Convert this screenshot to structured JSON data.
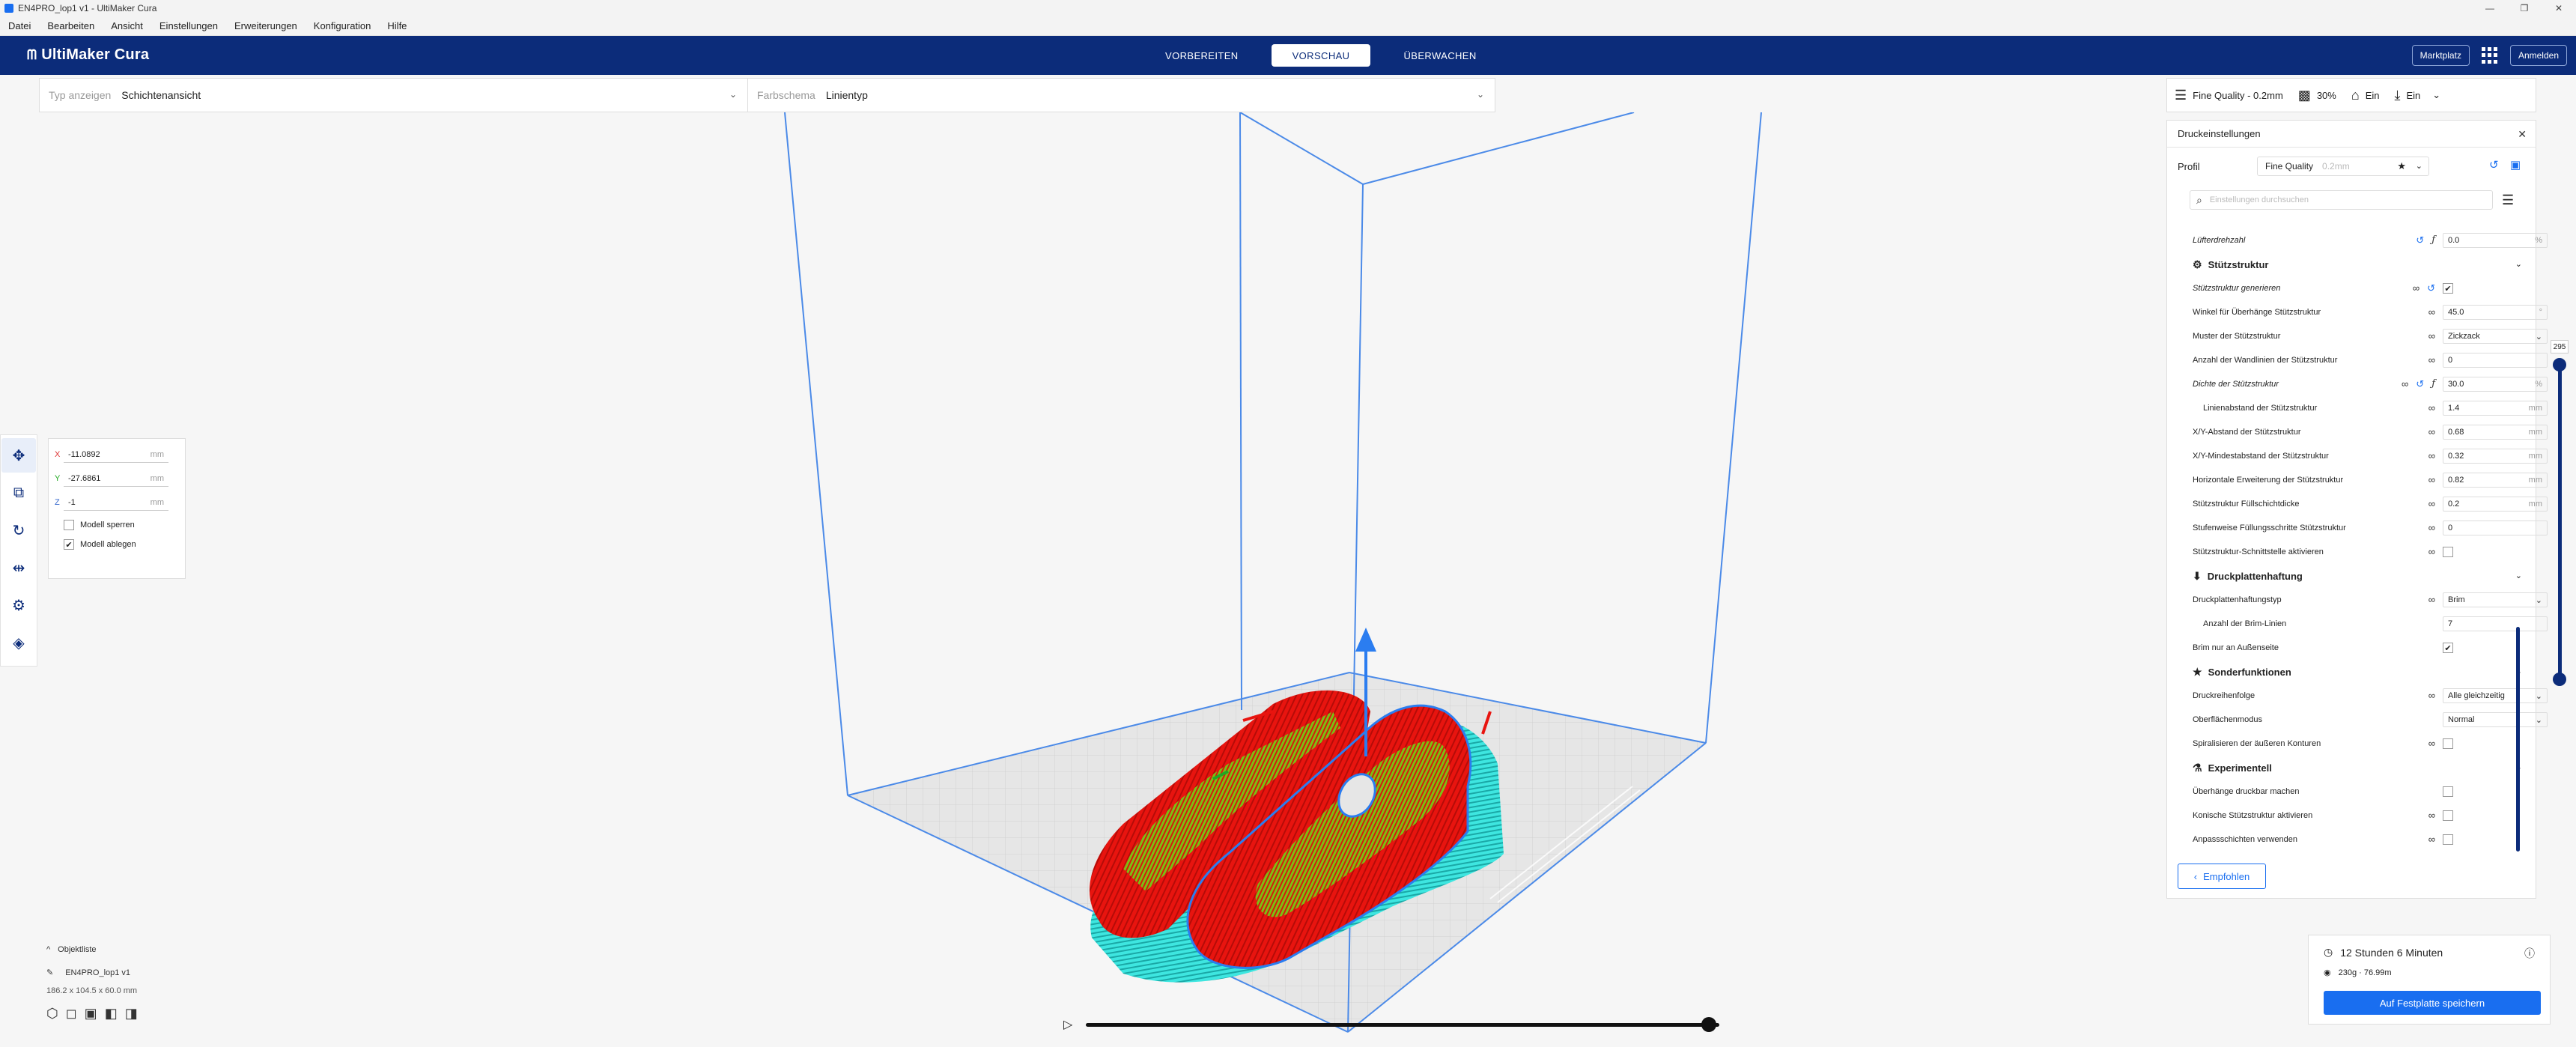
{
  "window": {
    "title": "EN4PRO_lop1 v1 - UltiMaker Cura",
    "controls": [
      "—",
      "❐",
      "✕"
    ]
  },
  "menu": [
    "Datei",
    "Bearbeiten",
    "Ansicht",
    "Einstellungen",
    "Erweiterungen",
    "Konfiguration",
    "Hilfe"
  ],
  "header": {
    "logo": "UltiMaker Cura",
    "stages": [
      "VORBEREITEN",
      "VORSCHAU",
      "ÜBERWACHEN"
    ],
    "active_stage": "VORSCHAU",
    "marketplace": "Marktplatz",
    "login": "Anmelden"
  },
  "viewbar": {
    "type_label": "Typ anzeigen",
    "type_value": "Schichtenansicht",
    "color_label": "Farbschema",
    "color_value": "Linientyp"
  },
  "printbar": {
    "profile": "Fine Quality - 0.2mm",
    "infill": "30%",
    "support": "Ein",
    "adhesion": "Ein"
  },
  "move_panel": {
    "x": "-11.0892",
    "y": "-27.6861",
    "z": "-1",
    "unit": "mm",
    "lock_label": "Modell sperren",
    "drop_label": "Modell ablegen",
    "lock_checked": false,
    "drop_checked": true
  },
  "objects": {
    "header": "Objektliste",
    "name": "EN4PRO_lop1 v1",
    "dims": "186.2 x 104.5 x 60.0 mm"
  },
  "panel": {
    "title": "Druckeinstellungen",
    "profile_label": "Profil",
    "profile_value": "Fine Quality",
    "profile_sub": "0.2mm",
    "search_placeholder": "Einstellungen durchsuchen",
    "recommend": "Empfohlen",
    "rows": [
      {
        "kind": "setting",
        "label": "Lüfterdrehzahl",
        "italic": true,
        "reset": true,
        "fx": true,
        "value": "0.0",
        "unit": "%"
      },
      {
        "kind": "category",
        "label": "Stützstruktur",
        "icon": "⚙"
      },
      {
        "kind": "setting",
        "label": "Stützstruktur generieren",
        "italic": true,
        "link": true,
        "reset": true,
        "check": true,
        "checked": true
      },
      {
        "kind": "setting",
        "label": "Winkel für Überhänge Stützstruktur",
        "link": true,
        "value": "45.0",
        "unit": "°"
      },
      {
        "kind": "setting",
        "label": "Muster der Stützstruktur",
        "link": true,
        "value": "Zickzack",
        "unit": "⌄",
        "dropdown": true
      },
      {
        "kind": "setting",
        "label": "Anzahl der Wandlinien der Stützstruktur",
        "link": true,
        "value": "0",
        "unit": ""
      },
      {
        "kind": "setting",
        "label": "Dichte der Stützstruktur",
        "italic": true,
        "link": true,
        "reset": true,
        "fx": true,
        "value": "30.0",
        "unit": "%"
      },
      {
        "kind": "setting",
        "label": "Linienabstand der Stützstruktur",
        "indent": true,
        "link": true,
        "value": "1.4",
        "unit": "mm"
      },
      {
        "kind": "setting",
        "label": "X/Y-Abstand der Stützstruktur",
        "link": true,
        "value": "0.68",
        "unit": "mm"
      },
      {
        "kind": "setting",
        "label": "X/Y-Mindestabstand der Stützstruktur",
        "link": true,
        "value": "0.32",
        "unit": "mm"
      },
      {
        "kind": "setting",
        "label": "Horizontale Erweiterung der Stützstruktur",
        "link": true,
        "value": "0.82",
        "unit": "mm"
      },
      {
        "kind": "setting",
        "label": "Stützstruktur Füllschichtdicke",
        "link": true,
        "value": "0.2",
        "unit": "mm"
      },
      {
        "kind": "setting",
        "label": "Stufenweise Füllungsschritte Stützstruktur",
        "link": true,
        "value": "0",
        "unit": ""
      },
      {
        "kind": "setting",
        "label": "Stützstruktur-Schnittstelle aktivieren",
        "link": true,
        "check": true,
        "checked": false
      },
      {
        "kind": "category",
        "label": "Druckplattenhaftung",
        "icon": "⬇"
      },
      {
        "kind": "setting",
        "label": "Druckplattenhaftungstyp",
        "link": true,
        "value": "Brim",
        "unit": "⌄",
        "dropdown": true
      },
      {
        "kind": "setting",
        "label": "Anzahl der Brim-Linien",
        "indent": true,
        "value": "7",
        "unit": ""
      },
      {
        "kind": "setting",
        "label": "Brim nur an Außenseite",
        "check": true,
        "checked": true
      },
      {
        "kind": "category",
        "label": "Sonderfunktionen",
        "icon": "★"
      },
      {
        "kind": "setting",
        "label": "Druckreihenfolge",
        "link": true,
        "value": "Alle gleichzeitig",
        "unit": "⌄",
        "dropdown": true
      },
      {
        "kind": "setting",
        "label": "Oberflächenmodus",
        "value": "Normal",
        "unit": "⌄",
        "dropdown": true
      },
      {
        "kind": "setting",
        "label": "Spiralisieren der äußeren Konturen",
        "link": true,
        "check": true,
        "checked": false
      },
      {
        "kind": "category",
        "label": "Experimentell",
        "icon": "⚗"
      },
      {
        "kind": "setting",
        "label": "Überhänge druckbar machen",
        "check": true,
        "checked": false
      },
      {
        "kind": "setting",
        "label": "Konische Stützstruktur aktivieren",
        "link": true,
        "check": true,
        "checked": false
      },
      {
        "kind": "setting",
        "label": "Anpassschichten verwenden",
        "link": true,
        "check": true,
        "checked": false
      }
    ]
  },
  "layer_slider": {
    "top_value": "295"
  },
  "print_info": {
    "time": "12 Stunden 6 Minuten",
    "material": "230g · 76.99m",
    "save": "Auf Festplatte speichern"
  },
  "colors": {
    "header": "#0c2c7a",
    "accent": "#196ef0",
    "model_red": "#e8140f",
    "model_cyan": "#3ee6e0",
    "model_green": "#7cbf14",
    "build_lines": "#4b8ae8"
  }
}
